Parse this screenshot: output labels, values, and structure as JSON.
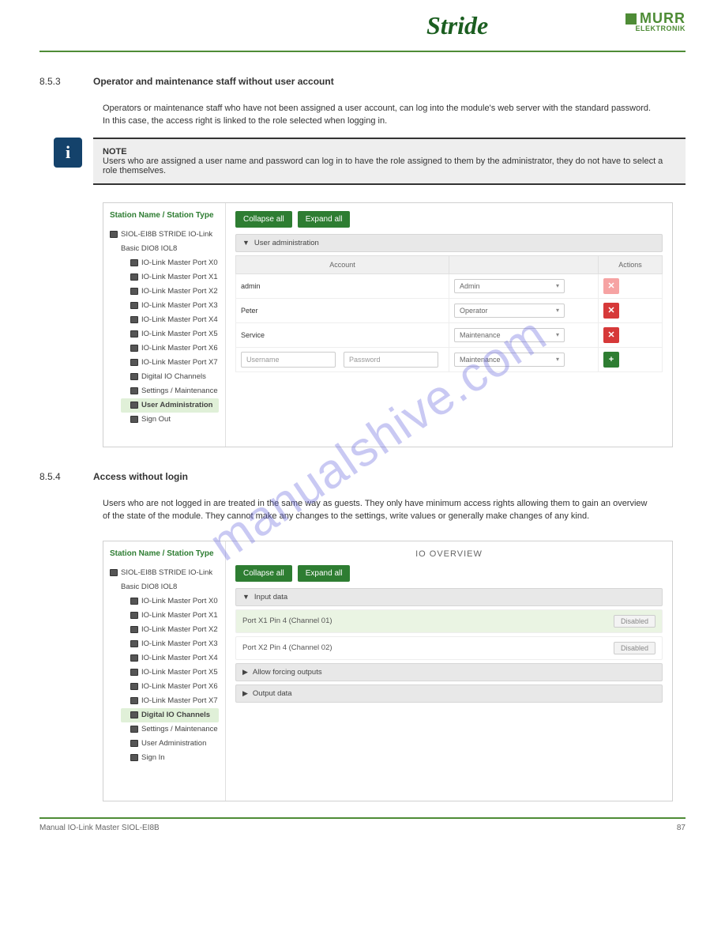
{
  "header": {
    "brand1": "Stride",
    "brand2": "MURR",
    "brand2_sub": "ELEKTRONIK"
  },
  "section1": {
    "num": "8.5.3",
    "title": "Operator and maintenance staff without user account",
    "body": "Operators or maintenance staff who have not been assigned a user account, can log into the module's web server with the standard password. In this case, the access right is linked to the role selected when logging in."
  },
  "note": {
    "label": "NOTE",
    "text": "Users who are assigned a user name and password can log in to have the role assigned to them by the administrator, they do not have to select a role themselves."
  },
  "panel1": {
    "sidebar_title": "Station Name / Station Type",
    "device": "SIOL-EI8B STRIDE IO-Link",
    "device_sub": "Basic DIO8 IOL8",
    "ports": [
      "IO-Link Master Port X0",
      "IO-Link Master Port X1",
      "IO-Link Master Port X2",
      "IO-Link Master Port X3",
      "IO-Link Master Port X4",
      "IO-Link Master Port X5",
      "IO-Link Master Port X6",
      "IO-Link Master Port X7"
    ],
    "extra": [
      "Digital IO Channels",
      "Settings / Maintenance"
    ],
    "active": "User Administration",
    "last": "Sign Out",
    "collapse": "Collapse all",
    "expand": "Expand all",
    "section_label": "User administration",
    "col_account": "Account",
    "col_actions": "Actions",
    "rows": [
      {
        "name": "admin",
        "role": "Admin",
        "act": "x",
        "cls": "act-del-pink"
      },
      {
        "name": "Peter",
        "role": "Operator",
        "act": "x",
        "cls": "act-del-red"
      },
      {
        "name": "Service",
        "role": "Maintenance",
        "act": "x",
        "cls": "act-del-red"
      }
    ],
    "new_user_ph": "Username",
    "new_pass_ph": "Password",
    "new_role": "Maintenance"
  },
  "section2": {
    "num": "8.5.4",
    "title": "Access without login",
    "body": "Users who are not logged in are treated in the same way as guests. They only have minimum access rights allowing them to gain an overview of the state of the module. They cannot make any changes to the settings, write values or generally make changes of any kind."
  },
  "panel2": {
    "sidebar_title": "Station Name / Station Type",
    "device": "SIOL-EI8B STRIDE IO-Link",
    "device_sub": "Basic DIO8 IOL8",
    "ports": [
      "IO-Link Master Port X0",
      "IO-Link Master Port X1",
      "IO-Link Master Port X2",
      "IO-Link Master Port X3",
      "IO-Link Master Port X4",
      "IO-Link Master Port X5",
      "IO-Link Master Port X6",
      "IO-Link Master Port X7"
    ],
    "active": "Digital IO Channels",
    "extra": [
      "Settings / Maintenance",
      "User Administration"
    ],
    "last": "Sign In",
    "title": "IO OVERVIEW",
    "collapse": "Collapse all",
    "expand": "Expand all",
    "sec_input": "Input data",
    "rows": [
      {
        "label": "Port X1 Pin 4 (Channel 01)",
        "status": "Disabled",
        "hl": true
      },
      {
        "label": "Port X2 Pin 4 (Channel 02)",
        "status": "Disabled",
        "hl": false
      }
    ],
    "sec_force": "Allow forcing outputs",
    "sec_output": "Output data"
  },
  "footer": {
    "left": "Manual IO-Link Master SIOL-EI8B",
    "right": "87"
  },
  "watermark": "manualshive.com"
}
